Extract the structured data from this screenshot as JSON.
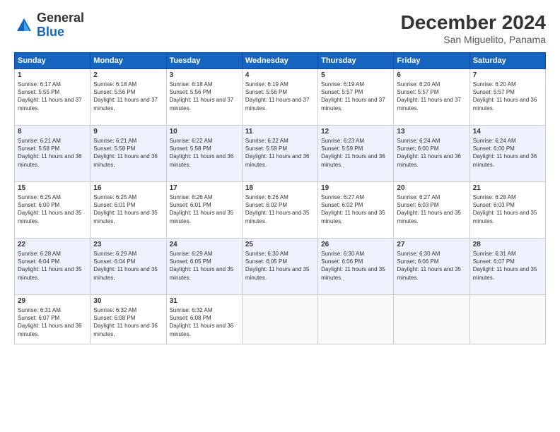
{
  "header": {
    "logo_general": "General",
    "logo_blue": "Blue",
    "month_title": "December 2024",
    "location": "San Miguelito, Panama"
  },
  "days_of_week": [
    "Sunday",
    "Monday",
    "Tuesday",
    "Wednesday",
    "Thursday",
    "Friday",
    "Saturday"
  ],
  "weeks": [
    [
      {
        "day": 1,
        "sunrise": "6:17 AM",
        "sunset": "5:55 PM",
        "daylight": "11 hours and 37 minutes."
      },
      {
        "day": 2,
        "sunrise": "6:18 AM",
        "sunset": "5:56 PM",
        "daylight": "11 hours and 37 minutes."
      },
      {
        "day": 3,
        "sunrise": "6:18 AM",
        "sunset": "5:56 PM",
        "daylight": "11 hours and 37 minutes."
      },
      {
        "day": 4,
        "sunrise": "6:19 AM",
        "sunset": "5:56 PM",
        "daylight": "11 hours and 37 minutes."
      },
      {
        "day": 5,
        "sunrise": "6:19 AM",
        "sunset": "5:57 PM",
        "daylight": "11 hours and 37 minutes."
      },
      {
        "day": 6,
        "sunrise": "6:20 AM",
        "sunset": "5:57 PM",
        "daylight": "11 hours and 37 minutes."
      },
      {
        "day": 7,
        "sunrise": "6:20 AM",
        "sunset": "5:57 PM",
        "daylight": "11 hours and 36 minutes."
      }
    ],
    [
      {
        "day": 8,
        "sunrise": "6:21 AM",
        "sunset": "5:58 PM",
        "daylight": "11 hours and 36 minutes."
      },
      {
        "day": 9,
        "sunrise": "6:21 AM",
        "sunset": "5:58 PM",
        "daylight": "11 hours and 36 minutes."
      },
      {
        "day": 10,
        "sunrise": "6:22 AM",
        "sunset": "5:58 PM",
        "daylight": "11 hours and 36 minutes."
      },
      {
        "day": 11,
        "sunrise": "6:22 AM",
        "sunset": "5:59 PM",
        "daylight": "11 hours and 36 minutes."
      },
      {
        "day": 12,
        "sunrise": "6:23 AM",
        "sunset": "5:59 PM",
        "daylight": "11 hours and 36 minutes."
      },
      {
        "day": 13,
        "sunrise": "6:24 AM",
        "sunset": "6:00 PM",
        "daylight": "11 hours and 36 minutes."
      },
      {
        "day": 14,
        "sunrise": "6:24 AM",
        "sunset": "6:00 PM",
        "daylight": "11 hours and 36 minutes."
      }
    ],
    [
      {
        "day": 15,
        "sunrise": "6:25 AM",
        "sunset": "6:00 PM",
        "daylight": "11 hours and 35 minutes."
      },
      {
        "day": 16,
        "sunrise": "6:25 AM",
        "sunset": "6:01 PM",
        "daylight": "11 hours and 35 minutes."
      },
      {
        "day": 17,
        "sunrise": "6:26 AM",
        "sunset": "6:01 PM",
        "daylight": "11 hours and 35 minutes."
      },
      {
        "day": 18,
        "sunrise": "6:26 AM",
        "sunset": "6:02 PM",
        "daylight": "11 hours and 35 minutes."
      },
      {
        "day": 19,
        "sunrise": "6:27 AM",
        "sunset": "6:02 PM",
        "daylight": "11 hours and 35 minutes."
      },
      {
        "day": 20,
        "sunrise": "6:27 AM",
        "sunset": "6:03 PM",
        "daylight": "11 hours and 35 minutes."
      },
      {
        "day": 21,
        "sunrise": "6:28 AM",
        "sunset": "6:03 PM",
        "daylight": "11 hours and 35 minutes."
      }
    ],
    [
      {
        "day": 22,
        "sunrise": "6:28 AM",
        "sunset": "6:04 PM",
        "daylight": "11 hours and 35 minutes."
      },
      {
        "day": 23,
        "sunrise": "6:29 AM",
        "sunset": "6:04 PM",
        "daylight": "11 hours and 35 minutes."
      },
      {
        "day": 24,
        "sunrise": "6:29 AM",
        "sunset": "6:05 PM",
        "daylight": "11 hours and 35 minutes."
      },
      {
        "day": 25,
        "sunrise": "6:30 AM",
        "sunset": "6:05 PM",
        "daylight": "11 hours and 35 minutes."
      },
      {
        "day": 26,
        "sunrise": "6:30 AM",
        "sunset": "6:06 PM",
        "daylight": "11 hours and 35 minutes."
      },
      {
        "day": 27,
        "sunrise": "6:30 AM",
        "sunset": "6:06 PM",
        "daylight": "11 hours and 35 minutes."
      },
      {
        "day": 28,
        "sunrise": "6:31 AM",
        "sunset": "6:07 PM",
        "daylight": "11 hours and 35 minutes."
      }
    ],
    [
      {
        "day": 29,
        "sunrise": "6:31 AM",
        "sunset": "6:07 PM",
        "daylight": "11 hours and 36 minutes."
      },
      {
        "day": 30,
        "sunrise": "6:32 AM",
        "sunset": "6:08 PM",
        "daylight": "11 hours and 36 minutes."
      },
      {
        "day": 31,
        "sunrise": "6:32 AM",
        "sunset": "6:08 PM",
        "daylight": "11 hours and 36 minutes."
      },
      null,
      null,
      null,
      null
    ]
  ]
}
